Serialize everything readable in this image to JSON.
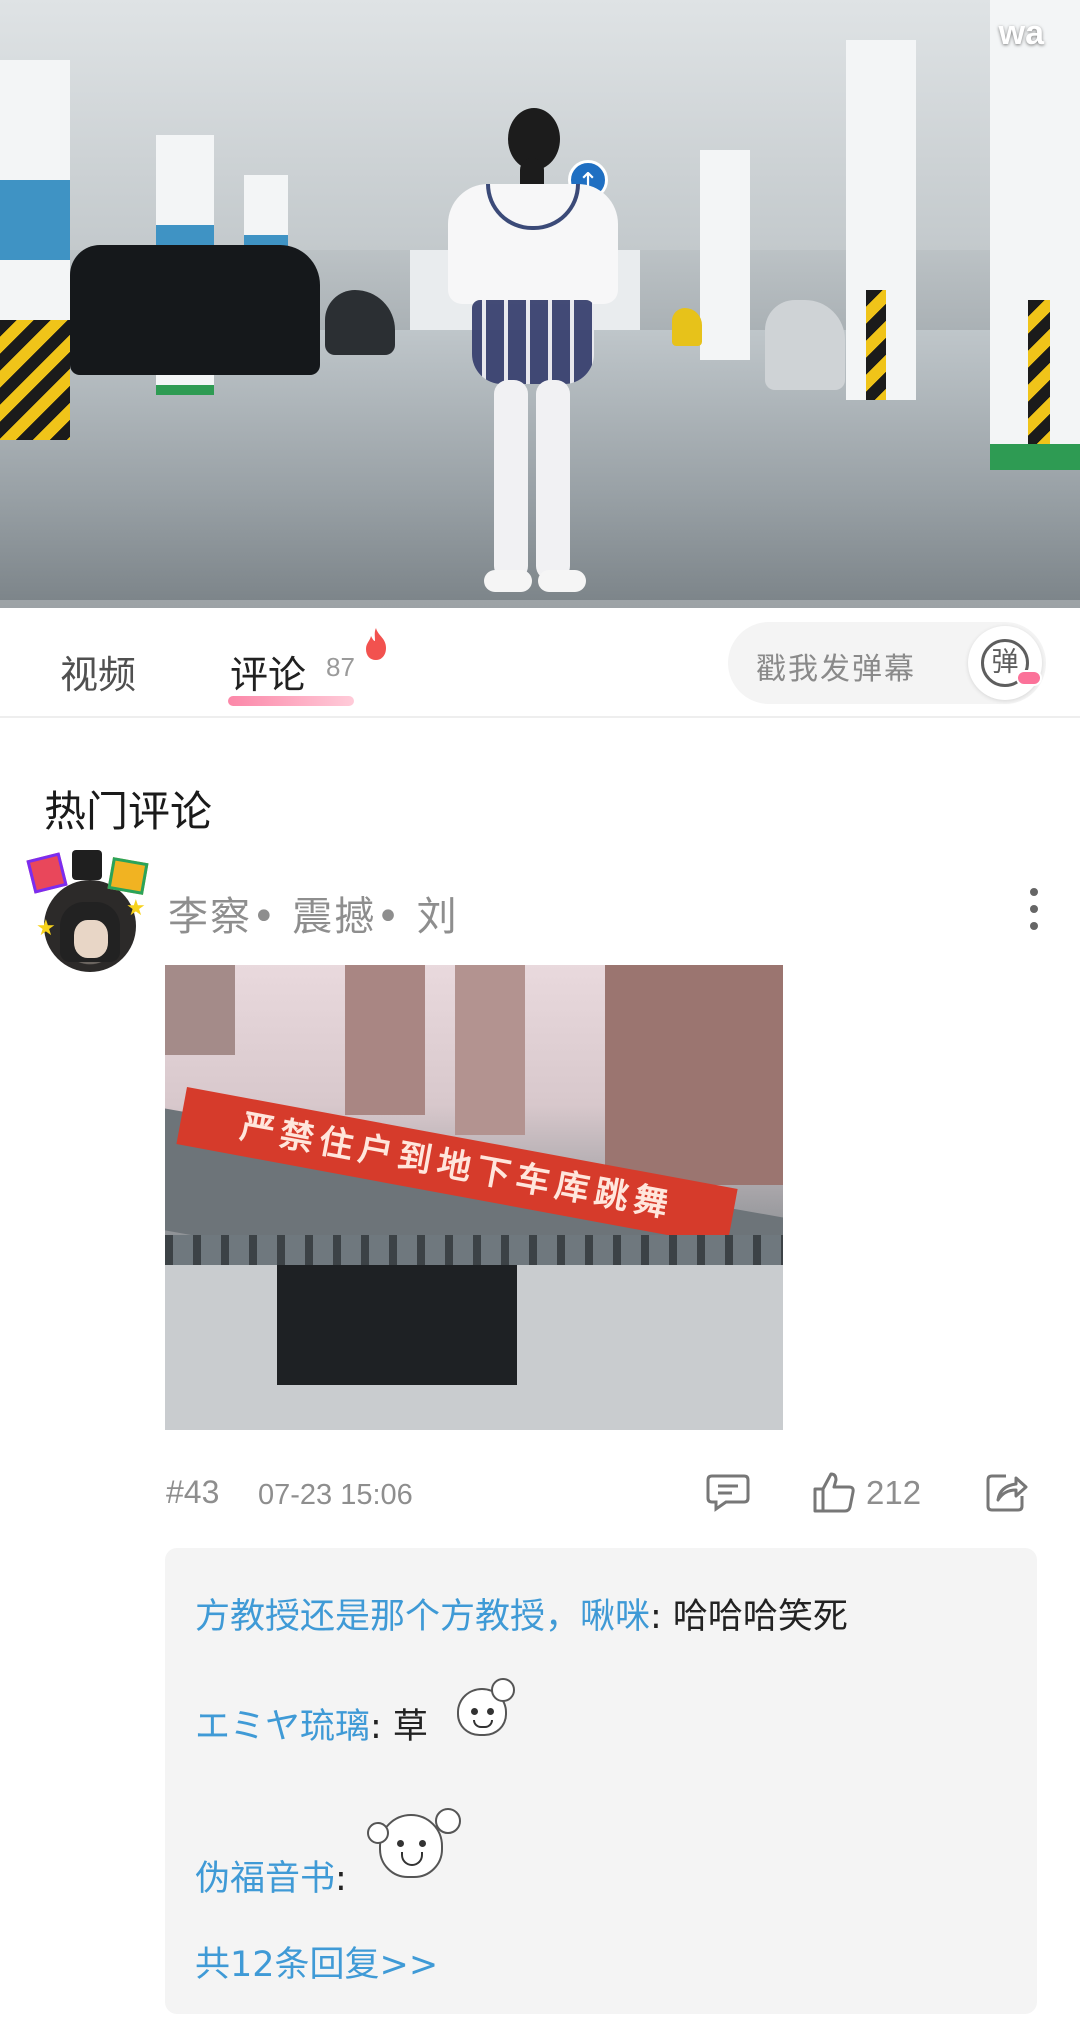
{
  "video": {
    "watermark": "wa",
    "progress": 0.0,
    "road_sign_icon": "up-arrow-icon"
  },
  "tabs": {
    "video_label": "视频",
    "comments_label": "评论",
    "comments_count": "87",
    "active": "comments",
    "hot_icon": "fire-icon"
  },
  "danmaku": {
    "placeholder": "戳我发弹幕",
    "toggle_glyph": "弹",
    "toggle_icon": "danmaku-toggle-icon"
  },
  "comments": {
    "section_title": "热门评论",
    "top": {
      "username": "李察• 震撼• 刘",
      "image_banner_text": "严禁住户到地下车库跳舞",
      "floor": "#43",
      "time": "07-23 15:06",
      "likes": "212",
      "replies": [
        {
          "name": "方教授还是那个方教授，啾咪",
          "text": ": 哈哈哈笑死",
          "sticker": ""
        },
        {
          "name": "エミヤ琉璃",
          "text": ": 草",
          "sticker": "smug-face-sticker-icon"
        },
        {
          "name": "伪福音书",
          "text": ":",
          "sticker": "crying-laugh-sticker-icon"
        }
      ],
      "view_all_replies": "共12条回复>>"
    }
  },
  "colors": {
    "accent_pink": "#fb7299",
    "link_blue": "#3f9ad6",
    "muted_gray": "#8e8e8e",
    "banner_red": "#d63b2b"
  }
}
